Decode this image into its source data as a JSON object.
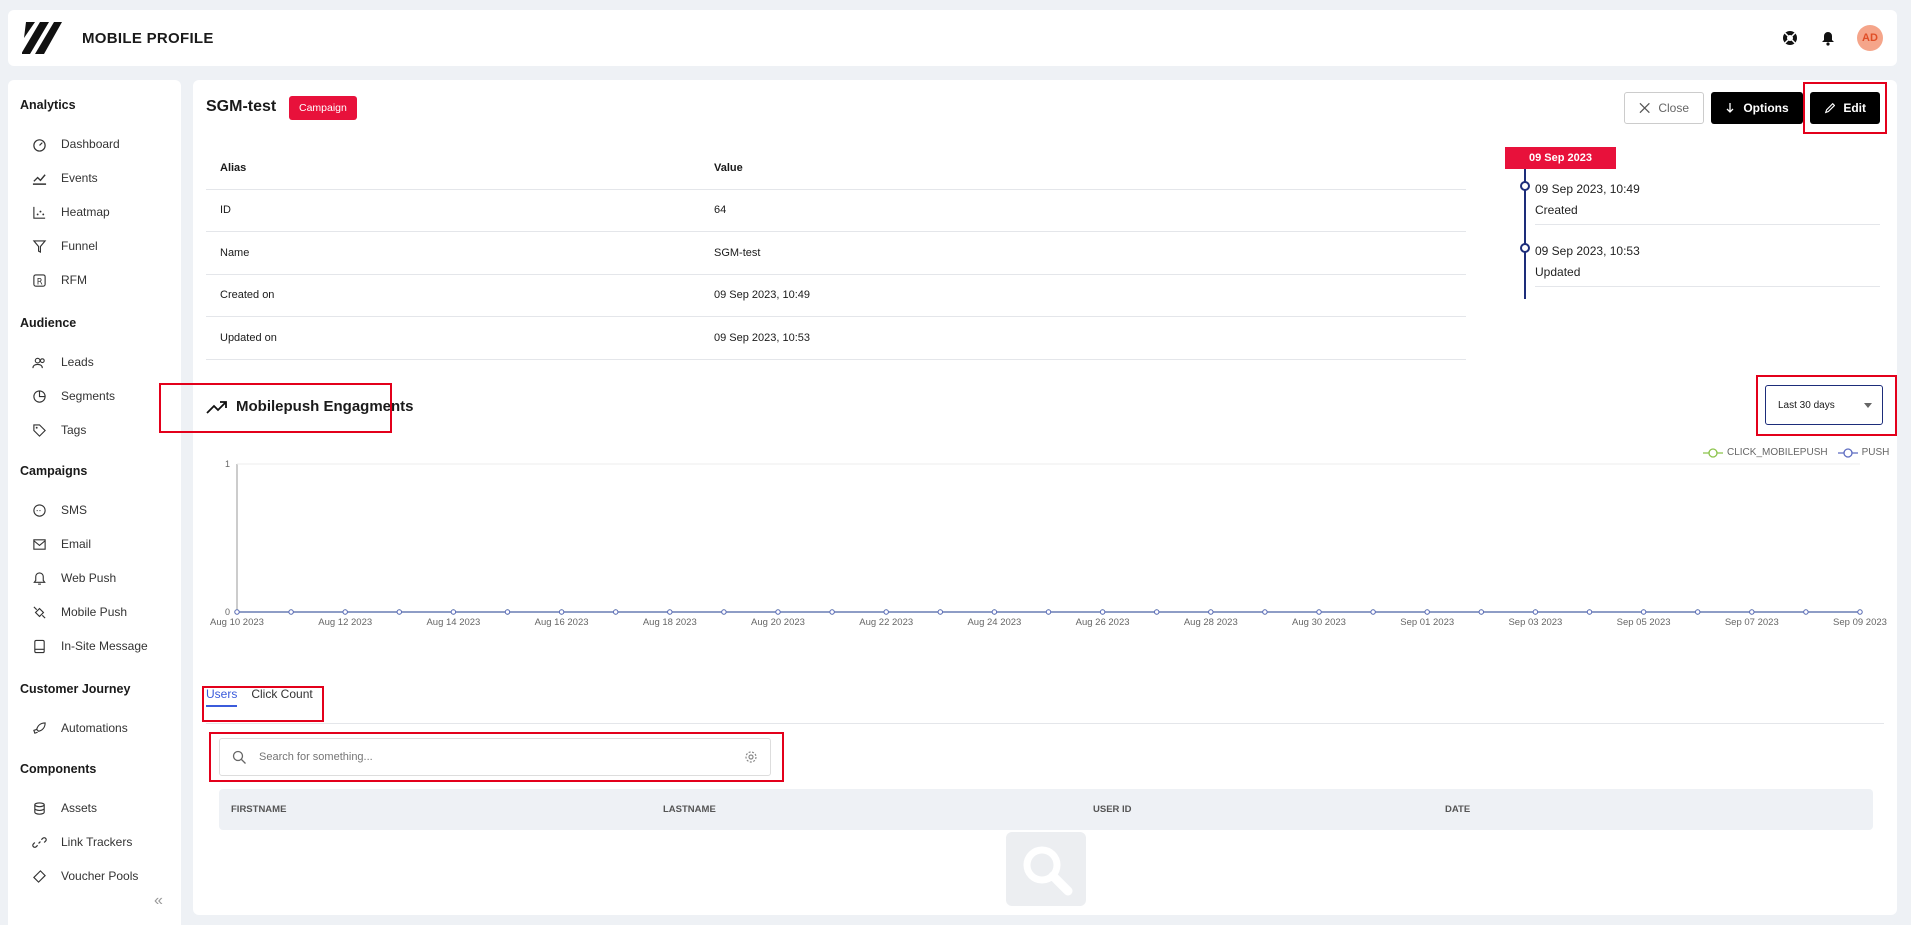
{
  "header": {
    "app_title": "MOBILE PROFILE",
    "avatar_initials": "AD"
  },
  "sidebar": {
    "sections": [
      {
        "title": "Analytics",
        "items": [
          "Dashboard",
          "Events",
          "Heatmap",
          "Funnel",
          "RFM"
        ]
      },
      {
        "title": "Audience",
        "items": [
          "Leads",
          "Segments",
          "Tags"
        ]
      },
      {
        "title": "Campaigns",
        "items": [
          "SMS",
          "Email",
          "Web Push",
          "Mobile Push",
          "In-Site Message"
        ]
      },
      {
        "title": "Customer Journey",
        "items": [
          "Automations"
        ]
      },
      {
        "title": "Components",
        "items": [
          "Assets",
          "Link Trackers",
          "Voucher Pools"
        ]
      }
    ]
  },
  "page": {
    "title": "SGM-test",
    "badge": "Campaign",
    "buttons": {
      "close": "Close",
      "options": "Options",
      "edit": "Edit"
    }
  },
  "properties": {
    "headers": [
      "Alias",
      "Value"
    ],
    "rows": [
      [
        "ID",
        "64"
      ],
      [
        "Name",
        "SGM-test"
      ],
      [
        "Created on",
        "09 Sep 2023, 10:49"
      ],
      [
        "Updated on",
        "09 Sep 2023, 10:53"
      ]
    ]
  },
  "timeline": {
    "date": "09 Sep 2023",
    "entries": [
      {
        "time": "09 Sep 2023, 10:49",
        "label": "Created"
      },
      {
        "time": "09 Sep 2023, 10:53",
        "label": "Updated"
      }
    ]
  },
  "engagements": {
    "title": "Mobilepush Engagments",
    "range_select": "Last 30 days"
  },
  "chart_data": {
    "type": "line",
    "x": [
      "Aug 10 2023",
      "Aug 11 2023",
      "Aug 12 2023",
      "Aug 13 2023",
      "Aug 14 2023",
      "Aug 15 2023",
      "Aug 16 2023",
      "Aug 17 2023",
      "Aug 18 2023",
      "Aug 19 2023",
      "Aug 20 2023",
      "Aug 21 2023",
      "Aug 22 2023",
      "Aug 23 2023",
      "Aug 24 2023",
      "Aug 25 2023",
      "Aug 26 2023",
      "Aug 27 2023",
      "Aug 28 2023",
      "Aug 29 2023",
      "Aug 30 2023",
      "Aug 31 2023",
      "Sep 01 2023",
      "Sep 02 2023",
      "Sep 03 2023",
      "Sep 04 2023",
      "Sep 05 2023",
      "Sep 06 2023",
      "Sep 07 2023",
      "Sep 08 2023",
      "Sep 09 2023"
    ],
    "tick_labels": [
      "Aug 10 2023",
      "Aug 12 2023",
      "Aug 14 2023",
      "Aug 16 2023",
      "Aug 18 2023",
      "Aug 20 2023",
      "Aug 22 2023",
      "Aug 24 2023",
      "Aug 26 2023",
      "Aug 28 2023",
      "Aug 30 2023",
      "Sep 01 2023",
      "Sep 03 2023",
      "Sep 05 2023",
      "Sep 07 2023",
      "Sep 09 2023"
    ],
    "series": [
      {
        "name": "CLICK_MOBILEPUSH",
        "color": "#8bc34a",
        "values": [
          0,
          0,
          0,
          0,
          0,
          0,
          0,
          0,
          0,
          0,
          0,
          0,
          0,
          0,
          0,
          0,
          0,
          0,
          0,
          0,
          0,
          0,
          0,
          0,
          0,
          0,
          0,
          0,
          0,
          0,
          0
        ]
      },
      {
        "name": "PUSH",
        "color": "#5c6bc0",
        "values": [
          0,
          0,
          0,
          0,
          0,
          0,
          0,
          0,
          0,
          0,
          0,
          0,
          0,
          0,
          0,
          0,
          0,
          0,
          0,
          0,
          0,
          0,
          0,
          0,
          0,
          0,
          0,
          0,
          0,
          0,
          0
        ]
      }
    ],
    "yticks": [
      0,
      1
    ],
    "ylim": [
      0,
      1
    ],
    "grid": false,
    "legend": "top-right"
  },
  "tabs": [
    "Users",
    "Click Count"
  ],
  "search": {
    "placeholder": "Search for something..."
  },
  "users_table": {
    "headers": [
      "FIRSTNAME",
      "LASTNAME",
      "USER ID",
      "DATE"
    ]
  }
}
